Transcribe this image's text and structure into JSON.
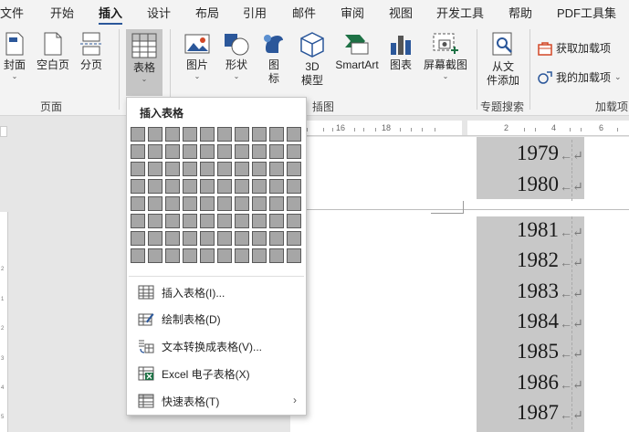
{
  "tabs": [
    "文件",
    "开始",
    "插入",
    "设计",
    "布局",
    "引用",
    "邮件",
    "审阅",
    "视图",
    "开发工具",
    "帮助",
    "PDF工具集"
  ],
  "active_tab": "插入",
  "ribbon": {
    "pages_group": {
      "label": "页面",
      "cover": "封面",
      "blank_page": "空白页",
      "page_break": "分页"
    },
    "table_group": {
      "table_button": "表格"
    },
    "illustrations_group": {
      "label": "插图",
      "picture": "图片",
      "shapes": "形状",
      "icons_line1": "图",
      "icons_line2": "标",
      "model_line1": "3D",
      "model_line2": "模型",
      "smartart": "SmartArt",
      "chart": "图表",
      "screenshot": "屏幕截图"
    },
    "search_group": {
      "label": "专题搜索",
      "from_doc_line1": "从文",
      "from_doc_line2": "件添加"
    },
    "addins_group": {
      "label": "加载项",
      "get_addins": "获取加载项",
      "my_addins": "我的加载项"
    },
    "caret": "⌄"
  },
  "ruler": {
    "h_labels": [
      "16",
      "18",
      "2",
      "4",
      "6"
    ],
    "v_labels": [
      "2",
      "1",
      "2",
      "3",
      "4",
      "5",
      "6"
    ]
  },
  "document": {
    "years": [
      "1979",
      "1980",
      "1981",
      "1982",
      "1983",
      "1984",
      "1985",
      "1986",
      "1987"
    ],
    "mark": "←↵"
  },
  "menu": {
    "title": "插入表格",
    "grid_cols": 10,
    "grid_rows": 8,
    "items": [
      {
        "label": "插入表格(I)...",
        "icon": "table-icon"
      },
      {
        "label": "绘制表格(D)",
        "icon": "draw-table-icon"
      },
      {
        "label": "文本转换成表格(V)...",
        "icon": "convert-text-icon"
      },
      {
        "label": "Excel 电子表格(X)",
        "icon": "excel-icon"
      },
      {
        "label": "快速表格(T)",
        "icon": "quick-table-icon",
        "submenu": "›"
      }
    ]
  },
  "colors": {
    "accent": "#2b579a",
    "table_shade": "#c8c8c8",
    "excel_green": "#1e7145",
    "orange_icon": "#d24726"
  }
}
